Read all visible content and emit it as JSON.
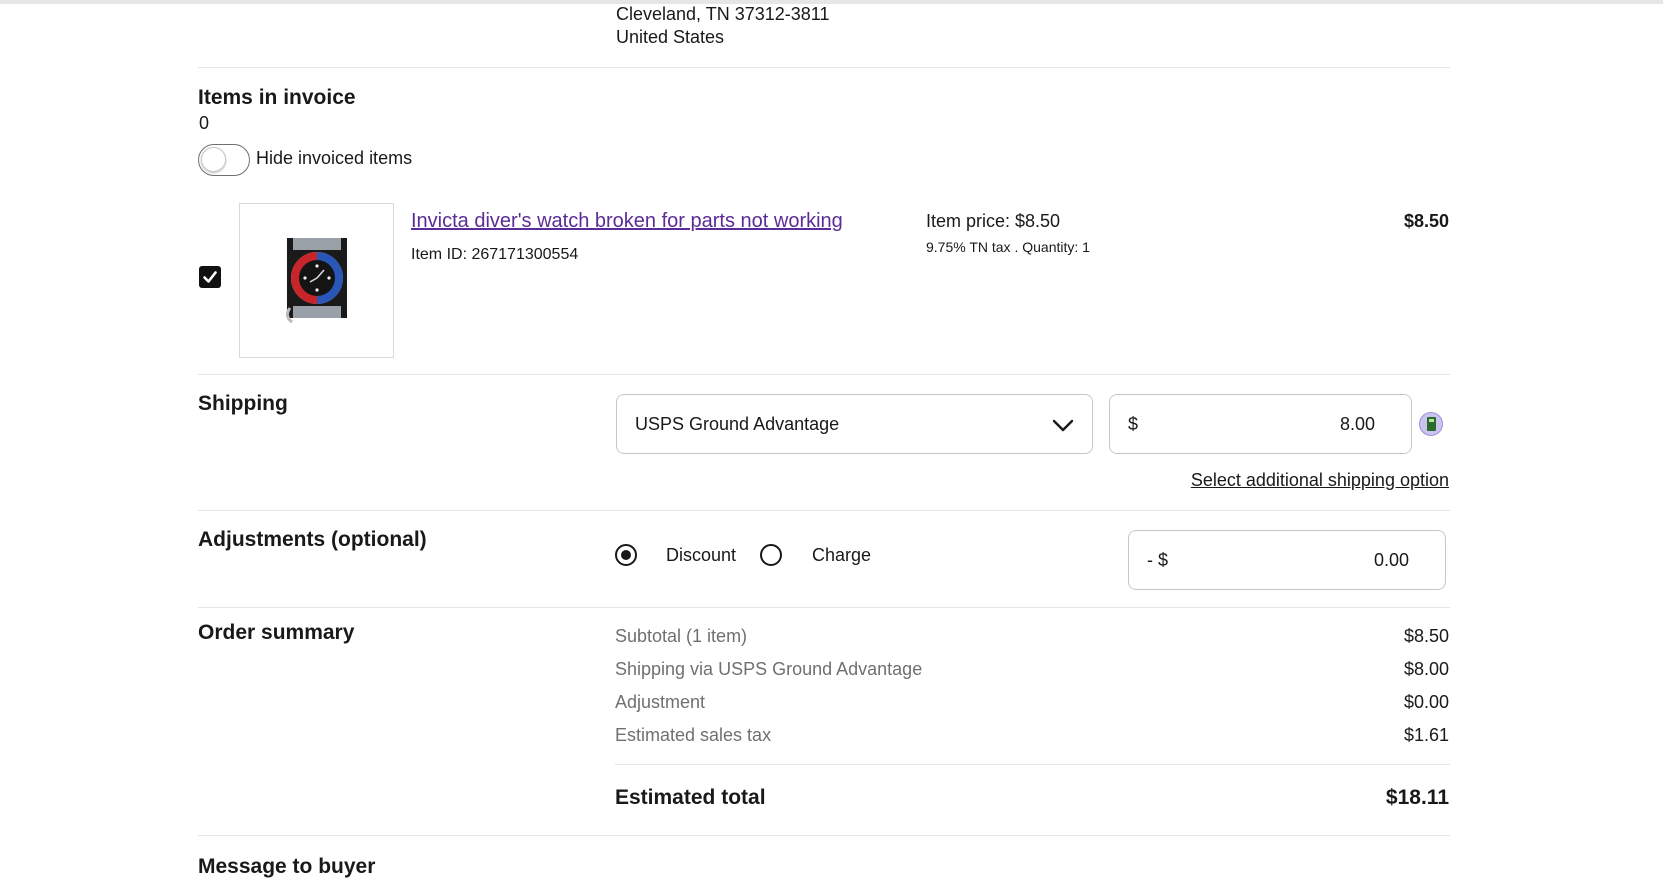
{
  "address": {
    "city_line": "Cleveland, TN 37312-3811",
    "country": "United States"
  },
  "items_section": {
    "title": "Items in invoice",
    "count": "0",
    "toggle_label": "Hide invoiced items"
  },
  "item": {
    "title": "Invicta diver's watch broken for parts not working",
    "item_id": "Item ID: 267171300554",
    "price_label": "Item price: $8.50",
    "tax_qty": "9.75% TN tax . Quantity: 1",
    "line_total": "$8.50",
    "checked": true,
    "thumbnail_icon": "watch-photo"
  },
  "shipping": {
    "title": "Shipping",
    "service": "USPS Ground Advantage",
    "currency": "$",
    "cost": "8.00",
    "additional_link": "Select additional shipping option"
  },
  "adjustments": {
    "title": "Adjustments (optional)",
    "discount_label": "Discount",
    "charge_label": "Charge",
    "selected": "Discount",
    "prefix": "- $",
    "amount": "0.00"
  },
  "order_summary": {
    "title": "Order summary",
    "rows": [
      {
        "label": "Subtotal (1 item)",
        "value": "$8.50"
      },
      {
        "label": "Shipping via USPS Ground Advantage",
        "value": "$8.00"
      },
      {
        "label": "Adjustment",
        "value": "$0.00"
      },
      {
        "label": "Estimated sales tax",
        "value": "$1.61"
      }
    ],
    "total_label": "Estimated total",
    "total_value": "$18.11"
  },
  "message": {
    "title": "Message to buyer"
  },
  "colors": {
    "link": "#5b2c97",
    "text": "#191919",
    "muted": "#707070",
    "border": "#c7c7c7"
  }
}
